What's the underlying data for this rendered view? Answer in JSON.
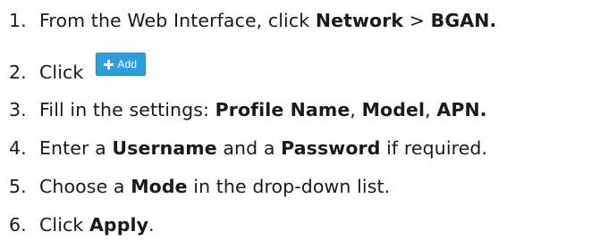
{
  "steps": [
    {
      "number": "1.",
      "parts": {
        "a": "From the Web Interface, click ",
        "b": "Network",
        "c": " > ",
        "d": "BGAN."
      }
    },
    {
      "number": "2.",
      "parts": {
        "a": "Click"
      },
      "button": {
        "label": "Add",
        "icon": "plus-icon"
      }
    },
    {
      "number": "3.",
      "parts": {
        "a": "Fill in the settings: ",
        "b": "Profile Name",
        "c": ", ",
        "d": "Model",
        "e": ", ",
        "f": "APN."
      }
    },
    {
      "number": "4.",
      "parts": {
        "a": "Enter a ",
        "b": "Username",
        "c": " and a ",
        "d": "Password",
        "e": " if required."
      }
    },
    {
      "number": "5.",
      "parts": {
        "a": "Choose a ",
        "b": "Mode",
        "c": " in the drop-down list."
      }
    },
    {
      "number": "6.",
      "parts": {
        "a": "Click ",
        "b": "Apply",
        "c": "."
      }
    }
  ],
  "colors": {
    "text": "#1a1a1a",
    "button_bg": "#2a9fe0",
    "button_text": "#ffffff"
  }
}
